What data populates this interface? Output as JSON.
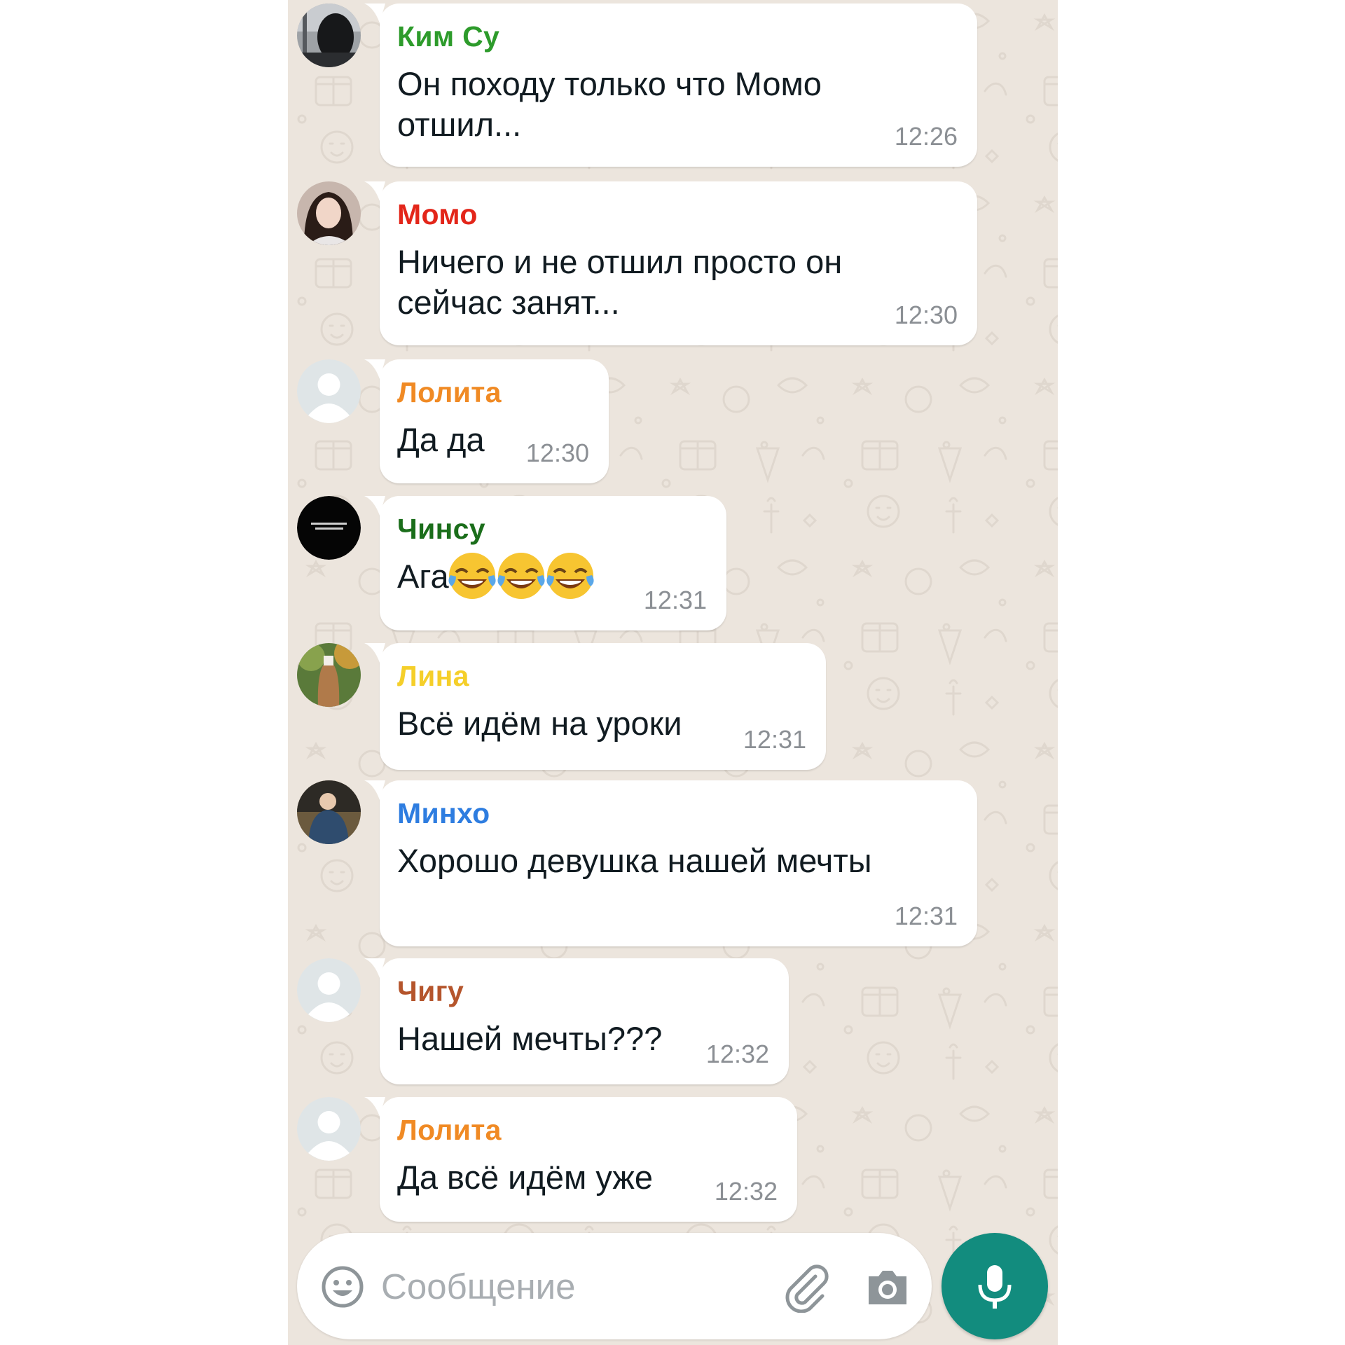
{
  "chat": {
    "messages": [
      {
        "sender": "Ким Су",
        "sender_color": "#2d9b2b",
        "text": "Он походу только что Момо\nотшил...",
        "time": "12:26",
        "avatar": "dark-figure-photo"
      },
      {
        "sender": "Момо",
        "sender_color": "#e3261a",
        "text": "Ничего и не отшил просто он\nсейчас занят...",
        "time": "12:30",
        "avatar": "girl-photo"
      },
      {
        "sender": "Лолита",
        "sender_color": "#f08a24",
        "text": "Да да",
        "time": "12:30",
        "avatar": "default-person"
      },
      {
        "sender": "Чинсу",
        "sender_color": "#1b6e1b",
        "text": "Ага",
        "emoji_count": 3,
        "emoji": "face-with-tears-of-joy",
        "time": "12:31",
        "avatar": "black-text-logo"
      },
      {
        "sender": "Лина",
        "sender_color": "#f5cf2a",
        "text": "Всё идём на уроки",
        "time": "12:31",
        "avatar": "autumn-photo"
      },
      {
        "sender": "Минхо",
        "sender_color": "#2e7de0",
        "text": "Хорошо девушка нашей мечты",
        "time": "12:31",
        "avatar": "boy-photo"
      },
      {
        "sender": "Чигу",
        "sender_color": "#b5552c",
        "text": "Нашей мечты???",
        "time": "12:32",
        "avatar": "default-person"
      },
      {
        "sender": "Лолита",
        "sender_color": "#f08a24",
        "text": "Да всё идём уже",
        "time": "12:32",
        "avatar": "default-person"
      }
    ]
  },
  "composer": {
    "placeholder": "Сообщение",
    "emoji_icon": "smiley-icon",
    "attach_icon": "paperclip-icon",
    "camera_icon": "camera-icon",
    "mic_icon": "microphone-icon",
    "accent_color": "#128c7e"
  }
}
